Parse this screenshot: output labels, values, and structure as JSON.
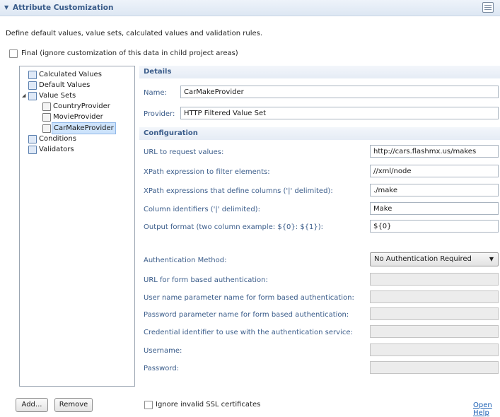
{
  "section": {
    "title": "Attribute Customization",
    "description": "Define default values, value sets, calculated values and validation rules.",
    "final_label": "Final (ignore customization of this data in child project areas)"
  },
  "tree": {
    "items": [
      {
        "label": "Calculated Values"
      },
      {
        "label": "Default Values"
      },
      {
        "label": "Value Sets"
      },
      {
        "label": "CountryProvider"
      },
      {
        "label": "MovieProvider"
      },
      {
        "label": "CarMakeProvider"
      },
      {
        "label": "Conditions"
      },
      {
        "label": "Validators"
      }
    ]
  },
  "buttons": {
    "add": "Add...",
    "remove": "Remove"
  },
  "details": {
    "title": "Details",
    "name_label": "Name:",
    "name_value": "CarMakeProvider",
    "provider_label": "Provider:",
    "provider_value": "HTTP Filtered Value Set"
  },
  "configuration": {
    "title": "Configuration",
    "rows": [
      {
        "label": "URL to request values:",
        "value": "http://cars.flashmx.us/makes"
      },
      {
        "label": "XPath expression to filter elements:",
        "value": "//xml/node"
      },
      {
        "label": "XPath expressions that define columns ('|' delimited):",
        "value": "./make"
      },
      {
        "label": "Column identifiers ('|' delimited):",
        "value": "Make"
      },
      {
        "label": "Output format (two column example: ${0}: ${1}):",
        "value": "${0}"
      }
    ],
    "auth_label": "Authentication Method:",
    "auth_value": "No Authentication Required",
    "auth_rows": [
      {
        "label": "URL for form based authentication:"
      },
      {
        "label": "User name parameter name for form based authentication:"
      },
      {
        "label": "Password parameter name for form based authentication:"
      },
      {
        "label": "Credential identifier to use with the authentication service:"
      },
      {
        "label": "Username:"
      },
      {
        "label": "Password:"
      }
    ]
  },
  "footer": {
    "ssl_label": "Ignore invalid SSL certificates",
    "help_link": "Open Help"
  }
}
